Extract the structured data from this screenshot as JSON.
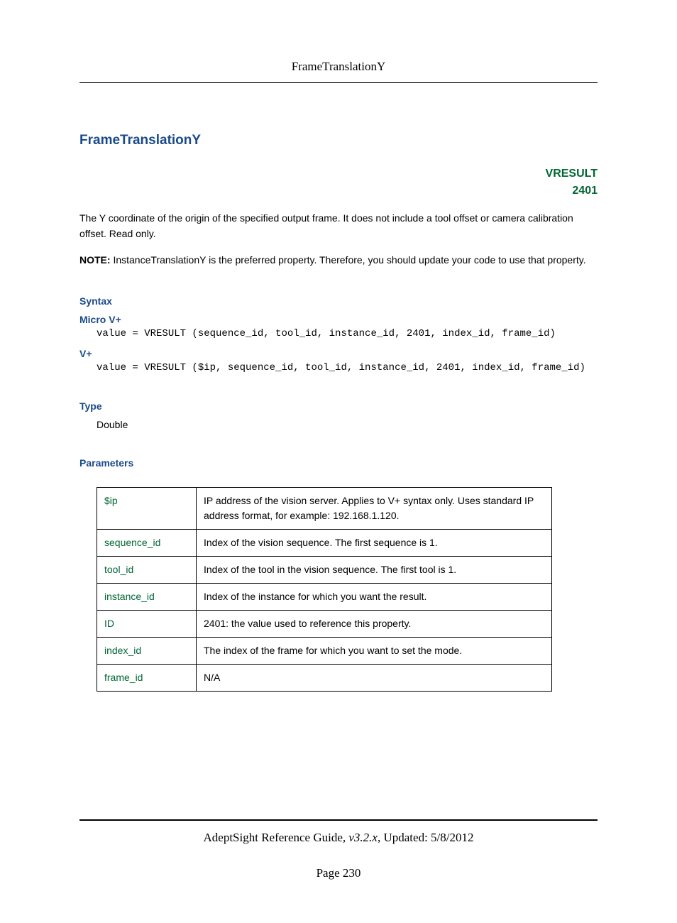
{
  "header": {
    "title": "FrameTranslationY"
  },
  "main": {
    "title": "FrameTranslationY",
    "vresult": {
      "label": "VRESULT",
      "code": "2401"
    },
    "intro": "The Y coordinate of the origin of the specified output frame. It does not include a tool offset or camera calibration offset. Read only.",
    "note_label": "NOTE:",
    "note_text": " InstanceTranslationY is the preferred property. Therefore, you should update your code to use that property.",
    "syntax": {
      "heading": "Syntax",
      "micro_label": "Micro V+",
      "micro_code": "value = VRESULT (sequence_id, tool_id, instance_id, 2401, index_id, frame_id)",
      "vplus_label": "V+",
      "vplus_code": "value = VRESULT ($ip, sequence_id, tool_id, instance_id, 2401, index_id, frame_id)"
    },
    "type": {
      "heading": "Type",
      "value": "Double"
    },
    "parameters": {
      "heading": "Parameters",
      "rows": [
        {
          "name": "$ip",
          "desc": "IP address of the vision server. Applies to V+ syntax only. Uses standard IP address format, for example: 192.168.1.120."
        },
        {
          "name": "sequence_id",
          "desc": "Index of the vision sequence. The first sequence is 1."
        },
        {
          "name": "tool_id",
          "desc": "Index of the tool in the vision sequence. The first tool is 1."
        },
        {
          "name": "instance_id",
          "desc": "Index of the instance for which you want the result."
        },
        {
          "name": "ID",
          "desc": "2401: the value used to reference this property."
        },
        {
          "name": "index_id",
          "desc": "The index of the frame for which you want to set the mode."
        },
        {
          "name": "frame_id",
          "desc": "N/A"
        }
      ]
    }
  },
  "footer": {
    "guide": "AdeptSight Reference Guide",
    "version": ", v3.2.x",
    "updated": ", Updated: 5/8/2012",
    "page": "Page 230"
  }
}
